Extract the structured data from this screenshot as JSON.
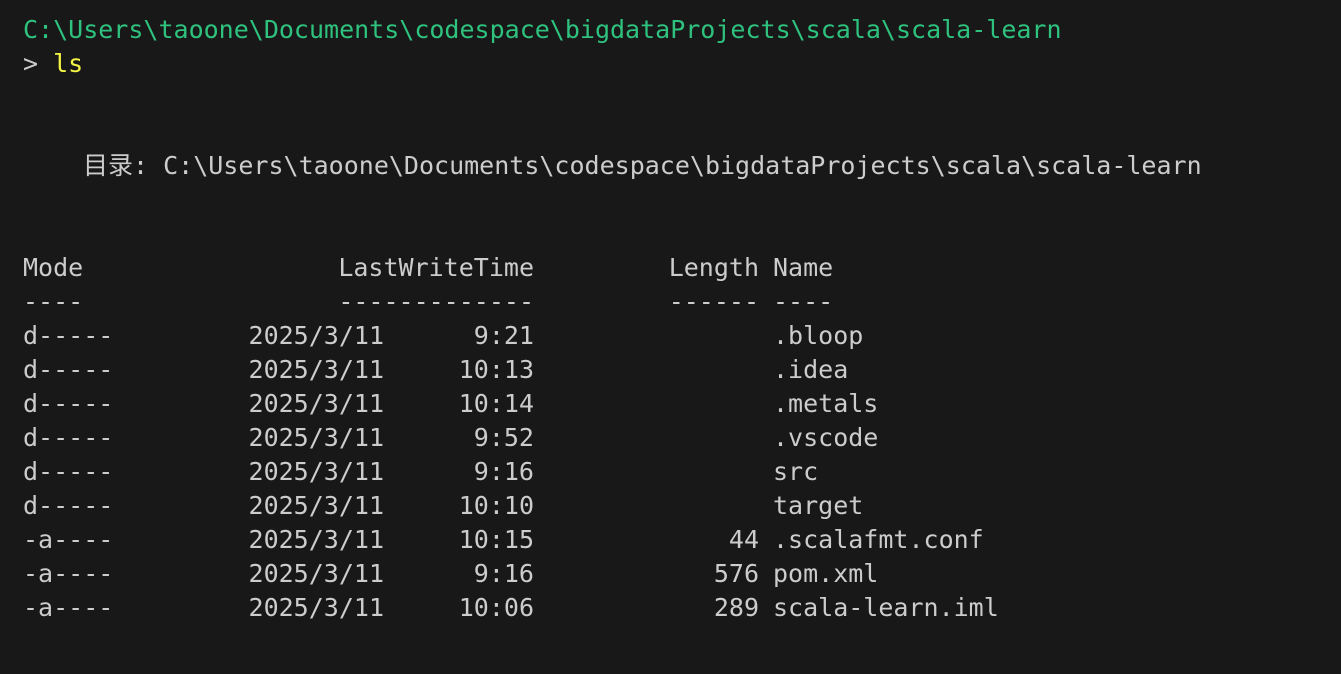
{
  "prompt": {
    "path": "C:\\Users\\taoone\\Documents\\codespace\\bigdataProjects\\scala\\scala-learn",
    "arrow": ">",
    "command": "ls"
  },
  "directory": {
    "label": "目录: C:\\Users\\taoone\\Documents\\codespace\\bigdataProjects\\scala\\scala-learn"
  },
  "table": {
    "headers": {
      "mode": "Mode",
      "time": "LastWriteTime",
      "length": "Length",
      "name": "Name"
    },
    "underlines": {
      "mode": "----",
      "time": "-------------",
      "length": "------",
      "name": "----"
    },
    "rows": [
      {
        "mode": "d-----",
        "date": "2025/3/11",
        "time": "9:21",
        "length": "",
        "name": ".bloop"
      },
      {
        "mode": "d-----",
        "date": "2025/3/11",
        "time": "10:13",
        "length": "",
        "name": ".idea"
      },
      {
        "mode": "d-----",
        "date": "2025/3/11",
        "time": "10:14",
        "length": "",
        "name": ".metals"
      },
      {
        "mode": "d-----",
        "date": "2025/3/11",
        "time": "9:52",
        "length": "",
        "name": ".vscode"
      },
      {
        "mode": "d-----",
        "date": "2025/3/11",
        "time": "9:16",
        "length": "",
        "name": "src"
      },
      {
        "mode": "d-----",
        "date": "2025/3/11",
        "time": "10:10",
        "length": "",
        "name": "target"
      },
      {
        "mode": "-a----",
        "date": "2025/3/11",
        "time": "10:15",
        "length": "44",
        "name": ".scalafmt.conf"
      },
      {
        "mode": "-a----",
        "date": "2025/3/11",
        "time": "9:16",
        "length": "576",
        "name": "pom.xml"
      },
      {
        "mode": "-a----",
        "date": "2025/3/11",
        "time": "10:06",
        "length": "289",
        "name": "scala-learn.iml"
      }
    ]
  },
  "colors": {
    "background": "#181818",
    "text": "#cccccc",
    "path": "#2ec27e",
    "command": "#f5f543"
  }
}
